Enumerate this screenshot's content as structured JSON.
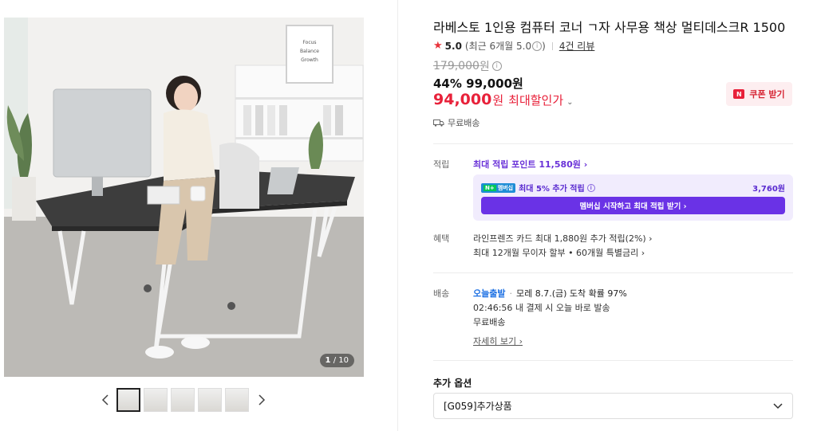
{
  "gallery": {
    "counter_current": "1",
    "counter_sep": "/",
    "counter_total": "10",
    "thumb_count": 5,
    "poster_text": [
      "Focus",
      "Balance",
      "Growth"
    ]
  },
  "product": {
    "title": "라베스토 1인용 컴퓨터 코너 ㄱ자 사무용 책상 멀티데스크R 1500",
    "rating_score": "5.0",
    "rating_recent": "(최근 6개월 5.0",
    "rating_recent_close": ")",
    "review_link": "4건 리뷰",
    "original_price": "179,000",
    "original_unit": "원",
    "discount_line": "44% 99,000원",
    "final_price": "94,000",
    "final_unit": "원",
    "final_label": "최대할인가",
    "coupon_label": "쿠폰 받기",
    "coupon_logo": "N",
    "shipping_text": "무료배송"
  },
  "points": {
    "label": "적립",
    "max_point": "최대 적립 포인트 11,580원 ›",
    "badge_text": "멤버십",
    "member_line": "최대 5% 추가 적립",
    "member_amount": "3,760원",
    "member_button": "멤버십 시작하고 최대 적립 받기 ›"
  },
  "benefits": {
    "label": "혜택",
    "items": [
      "라인프렌즈 카드 최대 1,880원 추가 적립(2%) ›",
      "최대 12개월 무이자 할부 • 60개월 특별금리 ›"
    ]
  },
  "delivery": {
    "label": "배송",
    "today": "오늘출발",
    "arrival": "모레 8.7.(금) 도착 확률 97%",
    "time_line": "02:46:56  내 결제 시 오늘 바로 발송",
    "free": "무료배송",
    "detail_link": "자세히 보기 ›"
  },
  "options": {
    "label": "추가 옵션",
    "selected": "[G059]추가상품"
  },
  "colors": {
    "price_red": "#e8213a",
    "point_purple": "#6a32e6",
    "today_blue": "#1b6fe3"
  }
}
